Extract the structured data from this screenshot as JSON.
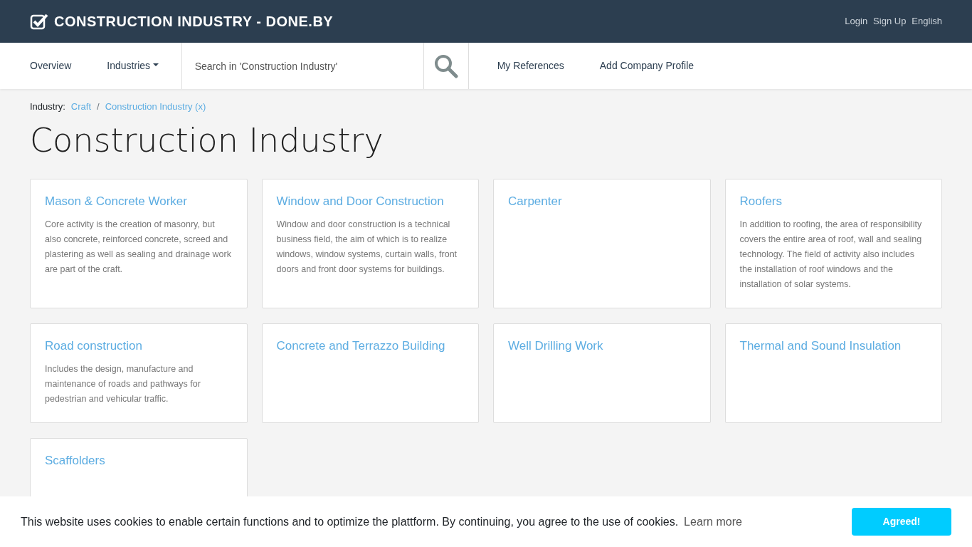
{
  "header": {
    "brand": "CONSTRUCTION INDUSTRY - DONE.BY",
    "links": [
      "Login",
      "Sign Up",
      "English"
    ]
  },
  "nav": {
    "items": [
      {
        "label": "Overview",
        "kind": "link"
      },
      {
        "label": "Industries",
        "kind": "dropdown"
      }
    ],
    "search": {
      "placeholder": "Search in 'Construction Industry'"
    },
    "right_items": [
      "My References",
      "Add Company Profile"
    ]
  },
  "breadcrumb": {
    "label": "Industry:",
    "items": [
      "Craft",
      "Construction Industry (x)"
    ],
    "separator": "/"
  },
  "title": "Construction Industry",
  "cards": [
    {
      "title": "Mason & Concrete Worker",
      "text": "Core activity is the creation of masonry, but also concrete, reinforced concrete, screed and plastering as well as sealing and drainage work are part of the craft."
    },
    {
      "title": "Window and Door Construction",
      "text": "Window and door construction is a technical business field, the aim of which is to realize windows, window systems, curtain walls, front doors and front door systems for buildings."
    },
    {
      "title": "Carpenter"
    },
    {
      "title": "Roofers",
      "text": "In addition to roofing, the area of responsibility covers the entire area of roof, wall and sealing technology. The field of activity also includes the installation of roof windows and the installation of solar systems."
    },
    {
      "title": "Road construction",
      "text": "Includes the design, manufacture and maintenance of roads and pathways for pedestrian and vehicular traffic."
    },
    {
      "title": "Concrete and Terrazzo Building"
    },
    {
      "title": "Well Drilling Work"
    },
    {
      "title": "Thermal and Sound Insulation"
    },
    {
      "title": "Scaffolders"
    }
  ],
  "cookie_bar": {
    "text": "This website uses cookies to enable certain functions and to optimize the plattform. By continuing, you agree to the use of cookies.",
    "link": "Learn more",
    "button": "Agreed!"
  }
}
